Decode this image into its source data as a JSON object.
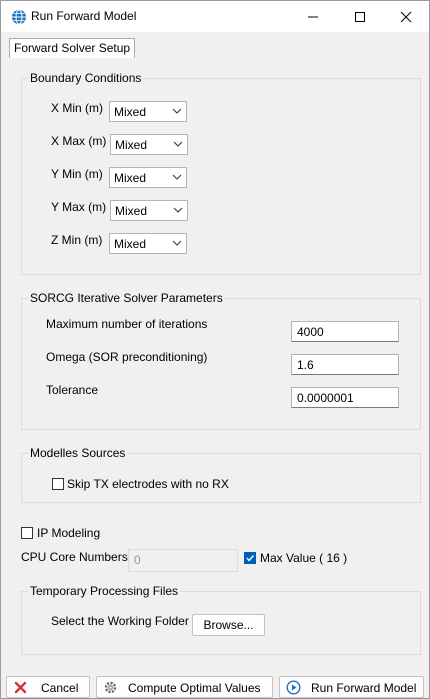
{
  "window": {
    "title": "Run Forward Model"
  },
  "tabs": [
    {
      "label": "Forward Solver Setup"
    }
  ],
  "boundary": {
    "title": "Boundary Conditions",
    "rows": [
      {
        "label": "X Min (m)",
        "value": "Mixed"
      },
      {
        "label": "X Max (m)",
        "value": "Mixed"
      },
      {
        "label": "Y Min (m)",
        "value": "Mixed"
      },
      {
        "label": "Y Max (m)",
        "value": "Mixed"
      },
      {
        "label": "Z Min (m)",
        "value": "Mixed"
      }
    ]
  },
  "sorcg": {
    "title": "SORCG Iterative Solver Parameters",
    "rows": [
      {
        "label": "Maximum number of iterations",
        "value": "4000"
      },
      {
        "label": "Omega (SOR preconditioning)",
        "value": "1.6"
      },
      {
        "label": "Tolerance",
        "value": "0.0000001"
      }
    ]
  },
  "sources": {
    "title": "Modelles Sources",
    "skip_label": "Skip TX electrodes with no RX",
    "skip_checked": false
  },
  "ip": {
    "label": "IP Modeling",
    "checked": false
  },
  "cpu": {
    "label": "CPU Core Numbers",
    "value": "0",
    "max_label": "Max Value ( 16 )",
    "max_checked": true
  },
  "temp": {
    "title": "Temporary Processing Files",
    "folder_label": "Select the Working Folder",
    "browse_label": "Browse..."
  },
  "footer": {
    "cancel_label": "Cancel",
    "compute_label": "Compute Optimal Values",
    "run_label": "Run Forward Model"
  },
  "colors": {
    "accent": "#005fb8",
    "cancel_red": "#d13438"
  }
}
